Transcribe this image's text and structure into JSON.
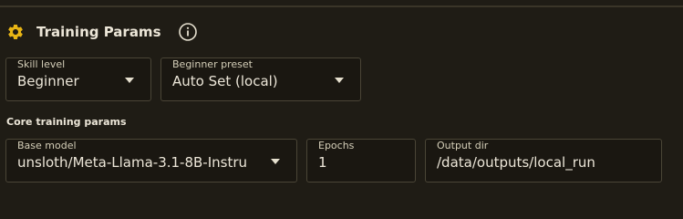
{
  "panel": {
    "title": "Training Params",
    "icons": {
      "settings": "gear-icon",
      "info": "info-icon"
    },
    "accent_color": "#e8b515"
  },
  "skill_level": {
    "label": "Skill level",
    "value": "Beginner"
  },
  "preset": {
    "label": "Beginner preset",
    "value": "Auto Set (local)"
  },
  "core": {
    "section_label": "Core training params",
    "base_model": {
      "label": "Base model",
      "value": "unsloth/Meta-Llama-3.1-8B-Instru"
    },
    "epochs": {
      "label": "Epochs",
      "value": "1"
    },
    "output_dir": {
      "label": "Output dir",
      "value": "/data/outputs/local_run"
    }
  }
}
